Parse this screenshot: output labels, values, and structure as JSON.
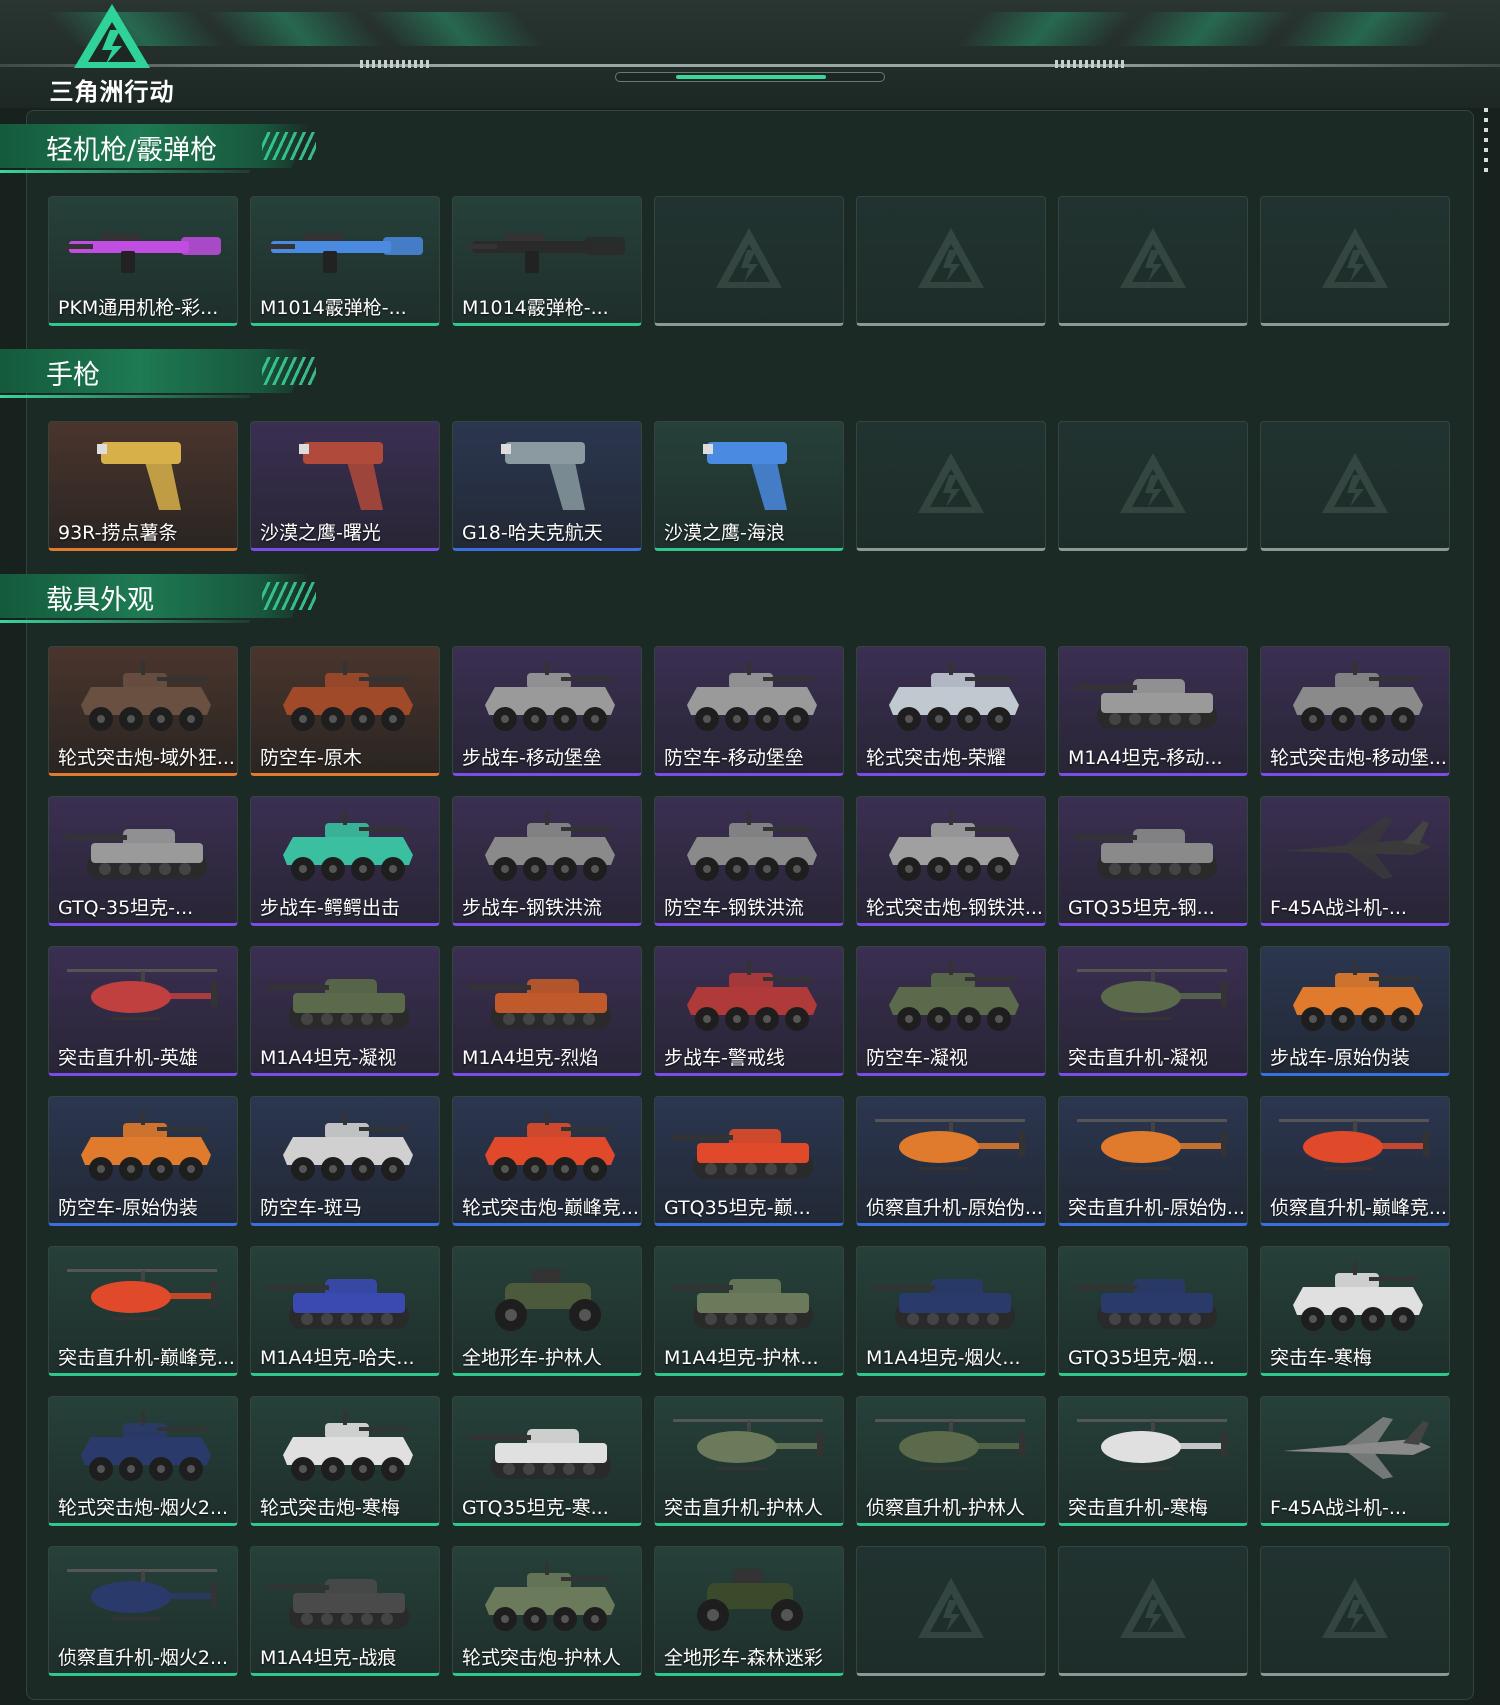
{
  "header": {
    "logo_text": "三角洲行动"
  },
  "sections": [
    {
      "title": "轻机枪/霰弹枪",
      "items": [
        {
          "label": "PKM通用机枪-彩...",
          "rarity": "green",
          "art": "rifle",
          "tint": "#c04ee0"
        },
        {
          "label": "M1014霰弹枪-...",
          "rarity": "green",
          "art": "rifle",
          "tint": "#4a8ae0"
        },
        {
          "label": "M1014霰弹枪-...",
          "rarity": "green",
          "art": "rifle",
          "tint": "#2a2a2a"
        },
        {
          "label": "",
          "rarity": "empty"
        },
        {
          "label": "",
          "rarity": "empty"
        },
        {
          "label": "",
          "rarity": "empty"
        },
        {
          "label": "",
          "rarity": "empty"
        }
      ]
    },
    {
      "title": "手枪",
      "items": [
        {
          "label": "93R-捞点薯条",
          "rarity": "orange",
          "art": "pistol",
          "tint": "#d8b04a"
        },
        {
          "label": "沙漠之鹰-曙光",
          "rarity": "purple",
          "art": "pistol",
          "tint": "#b04a3a"
        },
        {
          "label": "G18-哈夫克航天",
          "rarity": "blue",
          "art": "pistol",
          "tint": "#8a9aa0"
        },
        {
          "label": "沙漠之鹰-海浪",
          "rarity": "green",
          "art": "pistol",
          "tint": "#4a8ae0"
        },
        {
          "label": "",
          "rarity": "empty"
        },
        {
          "label": "",
          "rarity": "empty"
        },
        {
          "label": "",
          "rarity": "empty"
        }
      ]
    },
    {
      "title": "载具外观",
      "items": [
        {
          "label": "轮式突击炮-域外狂...",
          "rarity": "orange",
          "art": "wheeled",
          "tint": "#6a5040"
        },
        {
          "label": "防空车-原木",
          "rarity": "orange",
          "art": "wheeled",
          "tint": "#a04a2a"
        },
        {
          "label": "步战车-移动堡垒",
          "rarity": "purple",
          "art": "wheeled",
          "tint": "#9a9a9a"
        },
        {
          "label": "防空车-移动堡垒",
          "rarity": "purple",
          "art": "wheeled",
          "tint": "#9a9a9a"
        },
        {
          "label": "轮式突击炮-荣耀",
          "rarity": "purple",
          "art": "wheeled",
          "tint": "#c0c8d0"
        },
        {
          "label": "M1A4坦克-移动...",
          "rarity": "purple",
          "art": "tank",
          "tint": "#9a9a9a"
        },
        {
          "label": "轮式突击炮-移动堡...",
          "rarity": "purple",
          "art": "wheeled",
          "tint": "#8a8a8a"
        },
        {
          "label": "GTQ-35坦克-...",
          "rarity": "purple",
          "art": "tank",
          "tint": "#9a9a9a"
        },
        {
          "label": "步战车-鳄鳄出击",
          "rarity": "purple",
          "art": "wheeled",
          "tint": "#3ac0a0"
        },
        {
          "label": "步战车-钢铁洪流",
          "rarity": "purple",
          "art": "wheeled",
          "tint": "#8a8a8a"
        },
        {
          "label": "防空车-钢铁洪流",
          "rarity": "purple",
          "art": "wheeled",
          "tint": "#8a8a8a"
        },
        {
          "label": "轮式突击炮-钢铁洪...",
          "rarity": "purple",
          "art": "wheeled",
          "tint": "#a0a0a0"
        },
        {
          "label": "GTQ35坦克-钢...",
          "rarity": "purple",
          "art": "tank",
          "tint": "#8a8a8a"
        },
        {
          "label": "F-45A战斗机-...",
          "rarity": "purple",
          "art": "jet",
          "tint": "#3a3a3a"
        },
        {
          "label": "突击直升机-英雄",
          "rarity": "purple",
          "art": "heli",
          "tint": "#c04040"
        },
        {
          "label": "M1A4坦克-凝视",
          "rarity": "purple",
          "art": "tank",
          "tint": "#5a6a4a"
        },
        {
          "label": "M1A4坦克-烈焰",
          "rarity": "purple",
          "art": "tank",
          "tint": "#c05a2a"
        },
        {
          "label": "步战车-警戒线",
          "rarity": "purple",
          "art": "wheeled",
          "tint": "#b03a3a"
        },
        {
          "label": "防空车-凝视",
          "rarity": "purple",
          "art": "wheeled",
          "tint": "#5a6a4a"
        },
        {
          "label": "突击直升机-凝视",
          "rarity": "purple",
          "art": "heli",
          "tint": "#5a6a4a"
        },
        {
          "label": "步战车-原始伪装",
          "rarity": "blue",
          "art": "wheeled",
          "tint": "#e07a2c"
        },
        {
          "label": "防空车-原始伪装",
          "rarity": "blue",
          "art": "wheeled",
          "tint": "#e07a2c"
        },
        {
          "label": "防空车-斑马",
          "rarity": "blue",
          "art": "wheeled",
          "tint": "#d0d0d0"
        },
        {
          "label": "轮式突击炮-巅峰竞...",
          "rarity": "blue",
          "art": "wheeled",
          "tint": "#e04a2a"
        },
        {
          "label": "GTQ35坦克-巅...",
          "rarity": "blue",
          "art": "tank",
          "tint": "#e04a2a"
        },
        {
          "label": "侦察直升机-原始伪...",
          "rarity": "blue",
          "art": "heli",
          "tint": "#e07a2c"
        },
        {
          "label": "突击直升机-原始伪...",
          "rarity": "blue",
          "art": "heli",
          "tint": "#e07a2c"
        },
        {
          "label": "侦察直升机-巅峰竞...",
          "rarity": "blue",
          "art": "heli",
          "tint": "#e04a2a"
        },
        {
          "label": "突击直升机-巅峰竞...",
          "rarity": "green",
          "art": "heli",
          "tint": "#e04a2a"
        },
        {
          "label": "M1A4坦克-哈夫...",
          "rarity": "green",
          "art": "tank",
          "tint": "#3a4ab0"
        },
        {
          "label": "全地形车-护林人",
          "rarity": "green",
          "art": "atv",
          "tint": "#4a5a3a"
        },
        {
          "label": "M1A4坦克-护林...",
          "rarity": "green",
          "art": "tank",
          "tint": "#6a7a5a"
        },
        {
          "label": "M1A4坦克-烟火...",
          "rarity": "green",
          "art": "tank",
          "tint": "#2a3a6a"
        },
        {
          "label": "GTQ35坦克-烟...",
          "rarity": "green",
          "art": "tank",
          "tint": "#2a3a6a"
        },
        {
          "label": "突击车-寒梅",
          "rarity": "green",
          "art": "wheeled",
          "tint": "#e0e0e0"
        },
        {
          "label": "轮式突击炮-烟火2...",
          "rarity": "green",
          "art": "wheeled",
          "tint": "#2a3a6a"
        },
        {
          "label": "轮式突击炮-寒梅",
          "rarity": "green",
          "art": "wheeled",
          "tint": "#e0e0e0"
        },
        {
          "label": "GTQ35坦克-寒...",
          "rarity": "green",
          "art": "tank",
          "tint": "#e0e0e0"
        },
        {
          "label": "突击直升机-护林人",
          "rarity": "green",
          "art": "heli",
          "tint": "#6a7a5a"
        },
        {
          "label": "侦察直升机-护林人",
          "rarity": "green",
          "art": "heli",
          "tint": "#5a6a4a"
        },
        {
          "label": "突击直升机-寒梅",
          "rarity": "green",
          "art": "heli",
          "tint": "#e0e0e0"
        },
        {
          "label": "F-45A战斗机-...",
          "rarity": "green",
          "art": "jet",
          "tint": "#8a8a8a"
        },
        {
          "label": "侦察直升机-烟火2...",
          "rarity": "green",
          "art": "heli",
          "tint": "#2a3a6a"
        },
        {
          "label": "M1A4坦克-战痕",
          "rarity": "green",
          "art": "tank",
          "tint": "#4a4a4a"
        },
        {
          "label": "轮式突击炮-护林人",
          "rarity": "green",
          "art": "wheeled",
          "tint": "#6a7a5a"
        },
        {
          "label": "全地形车-森林迷彩",
          "rarity": "green",
          "art": "atv",
          "tint": "#3a4a2a"
        },
        {
          "label": "",
          "rarity": "empty"
        },
        {
          "label": "",
          "rarity": "empty"
        },
        {
          "label": "",
          "rarity": "empty"
        }
      ]
    }
  ]
}
